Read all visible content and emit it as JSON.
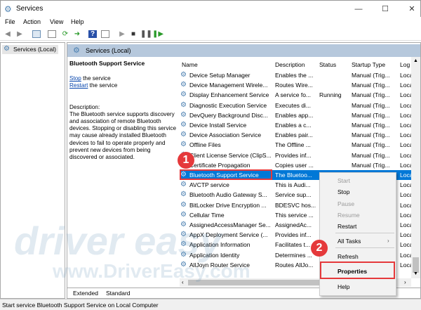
{
  "window": {
    "title": "Services",
    "minimize": "—",
    "maximize": "☐",
    "close": "✕"
  },
  "menu": [
    "File",
    "Action",
    "View",
    "Help"
  ],
  "toolbar": [
    "back-icon",
    "forward-icon",
    "console-tree-icon",
    "properties-icon",
    "refresh-icon",
    "export-icon",
    "help-icon",
    "view-icon",
    "start-icon",
    "stop-icon",
    "pause-icon",
    "restart-icon"
  ],
  "left_pane": {
    "tree_item": "Services (Local)"
  },
  "right_pane": {
    "header": "Services (Local)"
  },
  "details": {
    "title": "Bluetooth Support Service",
    "stop_link": "Stop",
    "stop_rest": " the service",
    "restart_link": "Restart",
    "restart_rest": " the service",
    "desc_label": "Description:",
    "desc_text": "The Bluetooth service supports discovery and association of remote Bluetooth devices.  Stopping or disabling this service may cause already installed Bluetooth devices to fail to operate properly and prevent new devices from being discovered or associated."
  },
  "columns": [
    "Name",
    "Description",
    "Status",
    "Startup Type",
    "Log"
  ],
  "rows": [
    [
      "Device Setup Manager",
      "Enables the ...",
      "",
      "Manual (Trig...",
      "Loca"
    ],
    [
      "Device Management Wirele...",
      "Routes Wire...",
      "",
      "Manual (Trig...",
      "Loca"
    ],
    [
      "Display Enhancement Service",
      "A service fo...",
      "Running",
      "Manual (Trig...",
      "Loca"
    ],
    [
      "Diagnostic Execution Service",
      "Executes di...",
      "",
      "Manual (Trig...",
      "Loca"
    ],
    [
      "DevQuery Background Disc...",
      "Enables app...",
      "",
      "Manual (Trig...",
      "Loca"
    ],
    [
      "Device Install Service",
      "Enables a c...",
      "",
      "Manual (Trig...",
      "Loca"
    ],
    [
      "Device Association Service",
      "Enables pair...",
      "",
      "Manual (Trig...",
      "Loca"
    ],
    [
      "Offline Files",
      "The Offline ...",
      "",
      "Manual (Trig...",
      "Loca"
    ],
    [
      "Client License Service (ClipS...",
      "Provides inf...",
      "",
      "Manual (Trig...",
      "Loca"
    ],
    [
      "Certificate Propagation",
      "Copies user ...",
      "",
      "Manual (Trig...",
      "Loca"
    ],
    [
      "Bluetooth Support Service",
      "The Bluetoo...",
      "Running",
      "Manual (Trig...",
      "Loca"
    ],
    [
      "AVCTP service",
      "This is Audi...",
      "",
      "",
      "Loca"
    ],
    [
      "Bluetooth Audio Gateway S...",
      "Service sup...",
      "",
      "",
      "Loca"
    ],
    [
      "BitLocker Drive Encryption ...",
      "BDESVC hos...",
      "",
      "",
      "Loca"
    ],
    [
      "Cellular Time",
      "This service ...",
      "",
      "",
      "Loca"
    ],
    [
      "AssignedAccessManager Se...",
      "AssignedAc...",
      "",
      "",
      "Loca"
    ],
    [
      "AppX Deployment Service (...",
      "Provides inf...",
      "",
      "",
      "Loca"
    ],
    [
      "Application Information",
      "Facilitates t...",
      "",
      "",
      "Loca"
    ],
    [
      "Application Identity",
      "Determines ...",
      "",
      "",
      "Loca"
    ],
    [
      "AllJoyn Router Service",
      "Routes AllJo...",
      "",
      "",
      "Loca"
    ]
  ],
  "selected_row": 10,
  "context_menu": {
    "start": "Start",
    "stop": "Stop",
    "pause": "Pause",
    "resume": "Resume",
    "restart": "Restart",
    "all_tasks": "All Tasks",
    "refresh": "Refresh",
    "properties": "Properties",
    "help": "Help"
  },
  "tabs": [
    "Extended",
    "Standard"
  ],
  "status_bar": "Start service Bluetooth Support Service on Local Computer",
  "annotations": {
    "step1": "1",
    "step2": "2",
    "color": "#e5393b"
  },
  "watermark": {
    "logo": "driver easy",
    "url": "www.DriverEasy.com"
  },
  "accent": "#0078d7"
}
